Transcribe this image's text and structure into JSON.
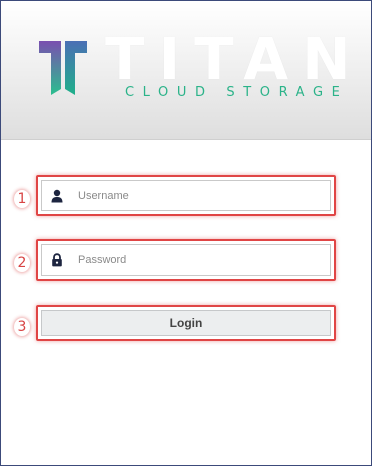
{
  "brand": {
    "name": "TITAN",
    "tagline": "CLOUD STORAGE",
    "logo_icon": "titan-t-logo-icon",
    "colors": {
      "accent_teal": "#2bb389",
      "logo_gradient_top": "#7a4fb0",
      "logo_gradient_bottom": "#2bbf8f"
    }
  },
  "form": {
    "username": {
      "step": "1",
      "placeholder": "Username",
      "value": "",
      "icon": "user-icon"
    },
    "password": {
      "step": "2",
      "placeholder": "Password",
      "value": "",
      "icon": "lock-icon"
    },
    "login": {
      "step": "3",
      "label": "Login"
    }
  },
  "annotation_color": "#e04545"
}
